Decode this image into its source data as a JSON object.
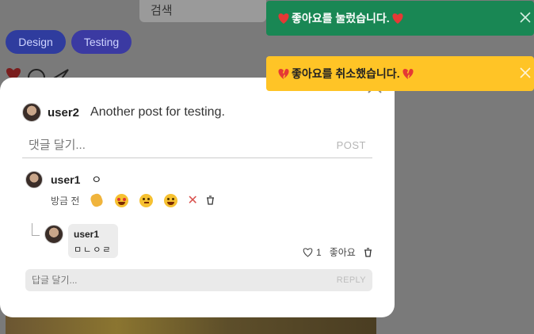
{
  "background": {
    "search_label": "검색",
    "tags": [
      "Design",
      "Testing"
    ]
  },
  "post": {
    "user": "user2",
    "text": "Another post for testing."
  },
  "comment_box": {
    "placeholder": "댓글 달기...",
    "post_label": "POST"
  },
  "comment": {
    "user": "user1",
    "text": "ㅇ",
    "time": "방금 전",
    "reactions": [
      "clapping-hands",
      "heart-eyes-face",
      "thinking-face",
      "laughing-face"
    ]
  },
  "reply": {
    "user": "user1",
    "text": "ㅁㄴㅇㄹ",
    "like_count": "1",
    "like_label": "좋아요"
  },
  "reply_box": {
    "placeholder": "답글 달기...",
    "reply_label": "REPLY"
  },
  "toasts": [
    {
      "text": "좋아요를 눌렀습니다.",
      "color": "#198754",
      "icon": "red-heart"
    },
    {
      "text": "좋아요를 취소했습니다.",
      "color": "#ffc426",
      "icon": "broken-heart"
    }
  ]
}
